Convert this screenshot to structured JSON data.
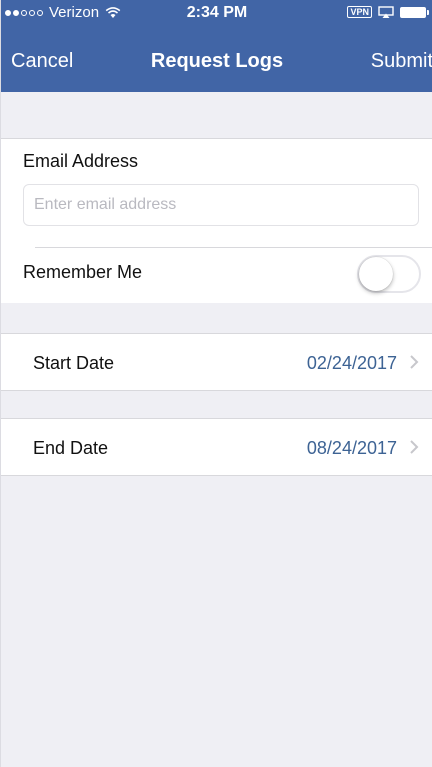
{
  "status_bar": {
    "carrier": "Verizon",
    "time": "2:34 PM",
    "vpn": "VPN",
    "signal_icon": "signal-dots-icon",
    "wifi_icon": "wifi-icon",
    "airplay_icon": "airplay-icon",
    "battery_icon": "battery-icon"
  },
  "nav": {
    "cancel_label": "Cancel",
    "title": "Request Logs",
    "submit_label": "Submit"
  },
  "form": {
    "email_label": "Email Address",
    "email_placeholder": "Enter email address",
    "email_value": "",
    "remember_label": "Remember Me",
    "remember_on": false
  },
  "dates": {
    "start_label": "Start Date",
    "start_value": "02/24/2017",
    "end_label": "End Date",
    "end_value": "08/24/2017"
  },
  "colors": {
    "nav_background": "#4165a6",
    "date_value": "#3d6394",
    "page_background": "#efeff4"
  }
}
